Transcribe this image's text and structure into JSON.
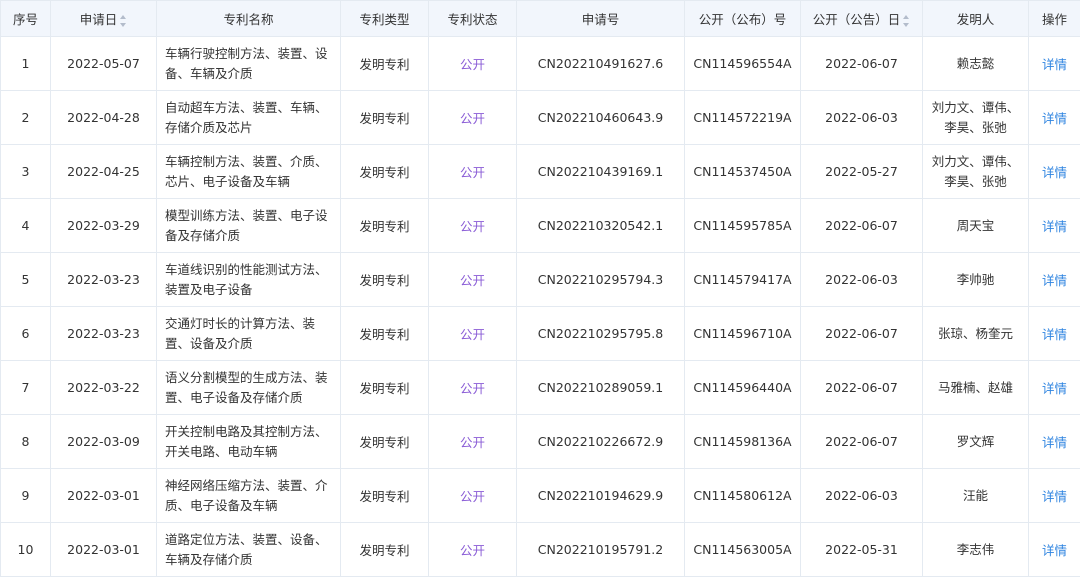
{
  "columns": {
    "index": "序号",
    "apply_date": "申请日",
    "title": "专利名称",
    "type": "专利类型",
    "status": "专利状态",
    "apply_no": "申请号",
    "pub_no": "公开（公布）号",
    "pub_date": "公开（公告）日",
    "inventors": "发明人",
    "action": "操作"
  },
  "rows": [
    {
      "index": "1",
      "apply_date": "2022-05-07",
      "title": "车辆行驶控制方法、装置、设备、车辆及介质",
      "type": "发明专利",
      "status": "公开",
      "apply_no": "CN202210491627.6",
      "pub_no": "CN114596554A",
      "pub_date": "2022-06-07",
      "inventors": "赖志懿",
      "action": "详情"
    },
    {
      "index": "2",
      "apply_date": "2022-04-28",
      "title": "自动超车方法、装置、车辆、存储介质及芯片",
      "type": "发明专利",
      "status": "公开",
      "apply_no": "CN202210460643.9",
      "pub_no": "CN114572219A",
      "pub_date": "2022-06-03",
      "inventors": "刘力文、谭伟、李昊、张弛",
      "action": "详情"
    },
    {
      "index": "3",
      "apply_date": "2022-04-25",
      "title": "车辆控制方法、装置、介质、芯片、电子设备及车辆",
      "type": "发明专利",
      "status": "公开",
      "apply_no": "CN202210439169.1",
      "pub_no": "CN114537450A",
      "pub_date": "2022-05-27",
      "inventors": "刘力文、谭伟、李昊、张弛",
      "action": "详情"
    },
    {
      "index": "4",
      "apply_date": "2022-03-29",
      "title": "模型训练方法、装置、电子设备及存储介质",
      "type": "发明专利",
      "status": "公开",
      "apply_no": "CN202210320542.1",
      "pub_no": "CN114595785A",
      "pub_date": "2022-06-07",
      "inventors": "周天宝",
      "action": "详情"
    },
    {
      "index": "5",
      "apply_date": "2022-03-23",
      "title": "车道线识别的性能测试方法、装置及电子设备",
      "type": "发明专利",
      "status": "公开",
      "apply_no": "CN202210295794.3",
      "pub_no": "CN114579417A",
      "pub_date": "2022-06-03",
      "inventors": "李帅驰",
      "action": "详情"
    },
    {
      "index": "6",
      "apply_date": "2022-03-23",
      "title": "交通灯时长的计算方法、装置、设备及介质",
      "type": "发明专利",
      "status": "公开",
      "apply_no": "CN202210295795.8",
      "pub_no": "CN114596710A",
      "pub_date": "2022-06-07",
      "inventors": "张琼、杨奎元",
      "action": "详情"
    },
    {
      "index": "7",
      "apply_date": "2022-03-22",
      "title": "语义分割模型的生成方法、装置、电子设备及存储介质",
      "type": "发明专利",
      "status": "公开",
      "apply_no": "CN202210289059.1",
      "pub_no": "CN114596440A",
      "pub_date": "2022-06-07",
      "inventors": "马雅楠、赵雄",
      "action": "详情"
    },
    {
      "index": "8",
      "apply_date": "2022-03-09",
      "title": "开关控制电路及其控制方法、开关电路、电动车辆",
      "type": "发明专利",
      "status": "公开",
      "apply_no": "CN202210226672.9",
      "pub_no": "CN114598136A",
      "pub_date": "2022-06-07",
      "inventors": "罗文辉",
      "action": "详情"
    },
    {
      "index": "9",
      "apply_date": "2022-03-01",
      "title": "神经网络压缩方法、装置、介质、电子设备及车辆",
      "type": "发明专利",
      "status": "公开",
      "apply_no": "CN202210194629.9",
      "pub_no": "CN114580612A",
      "pub_date": "2022-06-03",
      "inventors": "汪能",
      "action": "详情"
    },
    {
      "index": "10",
      "apply_date": "2022-03-01",
      "title": "道路定位方法、装置、设备、车辆及存储介质",
      "type": "发明专利",
      "status": "公开",
      "apply_no": "CN202210195791.2",
      "pub_no": "CN114563005A",
      "pub_date": "2022-05-31",
      "inventors": "李志伟",
      "action": "详情"
    }
  ],
  "colors": {
    "header_bg": "#f2f6fc",
    "border": "#e4eaf1",
    "status_text": "#8a5cd6",
    "link_text": "#2f84e0"
  }
}
